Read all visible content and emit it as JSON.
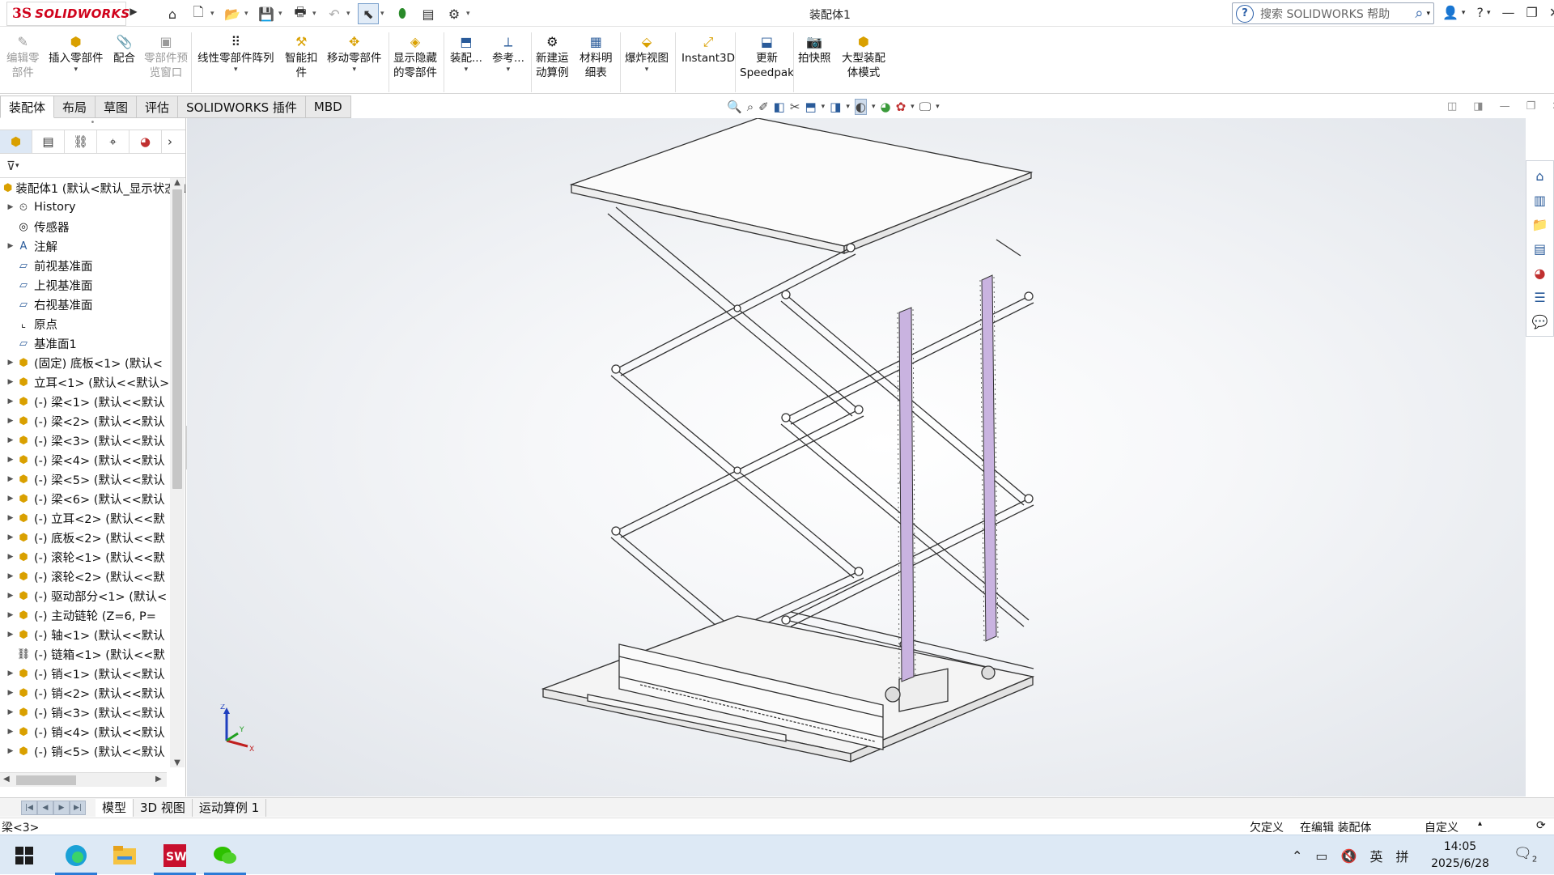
{
  "titlebar": {
    "logo_ds": "3S",
    "logo_text": "SOLIDWORKS",
    "document_title": "装配体1",
    "search_placeholder": "搜索 SOLIDWORKS 帮助",
    "quick_access": [
      "home-icon",
      "new-icon",
      "open-icon",
      "save-icon",
      "print-icon",
      "undo-icon",
      "select-icon",
      "rebuild-icon",
      "file-properties-icon",
      "options-icon"
    ]
  },
  "ribbon": {
    "buttons": [
      {
        "label": "编辑零\n部件",
        "enabled": false
      },
      {
        "label": "插入零部件",
        "enabled": true
      },
      {
        "label": "配合",
        "enabled": true
      },
      {
        "label": "零部件预\n览窗口",
        "enabled": false
      },
      {
        "label": "线性零部件阵列",
        "enabled": true
      },
      {
        "label": "智能扣\n件",
        "enabled": true
      },
      {
        "label": "移动零部件",
        "enabled": true
      },
      {
        "label": "显示隐藏\n的零部件",
        "enabled": true
      },
      {
        "label": "装配...",
        "enabled": true
      },
      {
        "label": "参考...",
        "enabled": true
      },
      {
        "label": "新建运\n动算例",
        "enabled": true
      },
      {
        "label": "材料明\n细表",
        "enabled": true
      },
      {
        "label": "爆炸视图",
        "enabled": true
      },
      {
        "label": "Instant3D",
        "enabled": true
      },
      {
        "label": "更新\nSpeedpak",
        "enabled": true
      },
      {
        "label": "拍快照",
        "enabled": true
      },
      {
        "label": "大型装配\n体模式",
        "enabled": true
      }
    ]
  },
  "command_tabs": [
    "装配体",
    "布局",
    "草图",
    "评估",
    "SOLIDWORKS 插件",
    "MBD"
  ],
  "active_command_tab": "装配体",
  "feature_tree": {
    "root": "装配体1 (默认<默认_显示状态-1>)",
    "nodes": [
      {
        "label": "History",
        "icon": "history-icon",
        "expand": true
      },
      {
        "label": "传感器",
        "icon": "sensor-icon",
        "expand": false
      },
      {
        "label": "注解",
        "icon": "annotation-icon",
        "expand": true
      },
      {
        "label": "前视基准面",
        "icon": "plane-icon",
        "expand": false
      },
      {
        "label": "上视基准面",
        "icon": "plane-icon",
        "expand": false
      },
      {
        "label": "右视基准面",
        "icon": "plane-icon",
        "expand": false
      },
      {
        "label": "原点",
        "icon": "origin-icon",
        "expand": false
      },
      {
        "label": "基准面1",
        "icon": "plane-icon",
        "expand": false
      },
      {
        "label": "(固定) 底板<1> (默认<",
        "icon": "part-icon",
        "expand": true
      },
      {
        "label": "立耳<1> (默认<<默认>",
        "icon": "part-icon",
        "expand": true
      },
      {
        "label": "(-) 梁<1> (默认<<默认",
        "icon": "part-icon",
        "expand": true
      },
      {
        "label": "(-) 梁<2> (默认<<默认",
        "icon": "part-icon",
        "expand": true
      },
      {
        "label": "(-) 梁<3> (默认<<默认",
        "icon": "part-icon",
        "expand": true
      },
      {
        "label": "(-) 梁<4> (默认<<默认",
        "icon": "part-icon",
        "expand": true
      },
      {
        "label": "(-) 梁<5> (默认<<默认",
        "icon": "part-icon",
        "expand": true
      },
      {
        "label": "(-) 梁<6> (默认<<默认",
        "icon": "part-icon",
        "expand": true
      },
      {
        "label": "(-) 立耳<2> (默认<<默",
        "icon": "part-icon",
        "expand": true
      },
      {
        "label": "(-) 底板<2> (默认<<默",
        "icon": "part-icon",
        "expand": true
      },
      {
        "label": "(-) 滚轮<1> (默认<<默",
        "icon": "part-icon",
        "expand": true
      },
      {
        "label": "(-) 滚轮<2> (默认<<默",
        "icon": "part-icon",
        "expand": true
      },
      {
        "label": "(-) 驱动部分<1> (默认<",
        "icon": "part-icon",
        "expand": true
      },
      {
        "label": "(-) 主动链轮 (Z=6, P=",
        "icon": "part-icon",
        "expand": true
      },
      {
        "label": "(-) 轴<1> (默认<<默认",
        "icon": "part-icon",
        "expand": true
      },
      {
        "label": "(-) 链箱<1> (默认<<默",
        "icon": "chain-icon",
        "expand": false
      },
      {
        "label": "(-) 销<1> (默认<<默认",
        "icon": "part-icon",
        "expand": true
      },
      {
        "label": "(-) 销<2> (默认<<默认",
        "icon": "part-icon",
        "expand": true
      },
      {
        "label": "(-) 销<3> (默认<<默认",
        "icon": "part-icon",
        "expand": true
      },
      {
        "label": "(-) 销<4> (默认<<默认",
        "icon": "part-icon",
        "expand": true
      },
      {
        "label": "(-) 销<5> (默认<<默认",
        "icon": "part-icon",
        "expand": true
      }
    ]
  },
  "bottom_tabs": [
    "模型",
    "3D 视图",
    "运动算例 1"
  ],
  "active_bottom_tab": "模型",
  "status": {
    "selection": "梁<3>",
    "definition": "欠定义",
    "editing": "在编辑 装配体",
    "units": "自定义"
  },
  "taskbar": {
    "time": "14:05",
    "date": "2025/6/28",
    "ime": "英",
    "ime2": "拼",
    "notif_count": "2",
    "apps": [
      "windows-start-icon",
      "edge-icon",
      "file-explorer-icon",
      "solidworks-icon",
      "wechat-icon"
    ]
  },
  "triad": {
    "z": "Z",
    "y": "Y",
    "x": "X"
  },
  "colors": {
    "brand": "#d0021b",
    "chain": "#b49ad1",
    "accent": "#2c7bd6"
  }
}
